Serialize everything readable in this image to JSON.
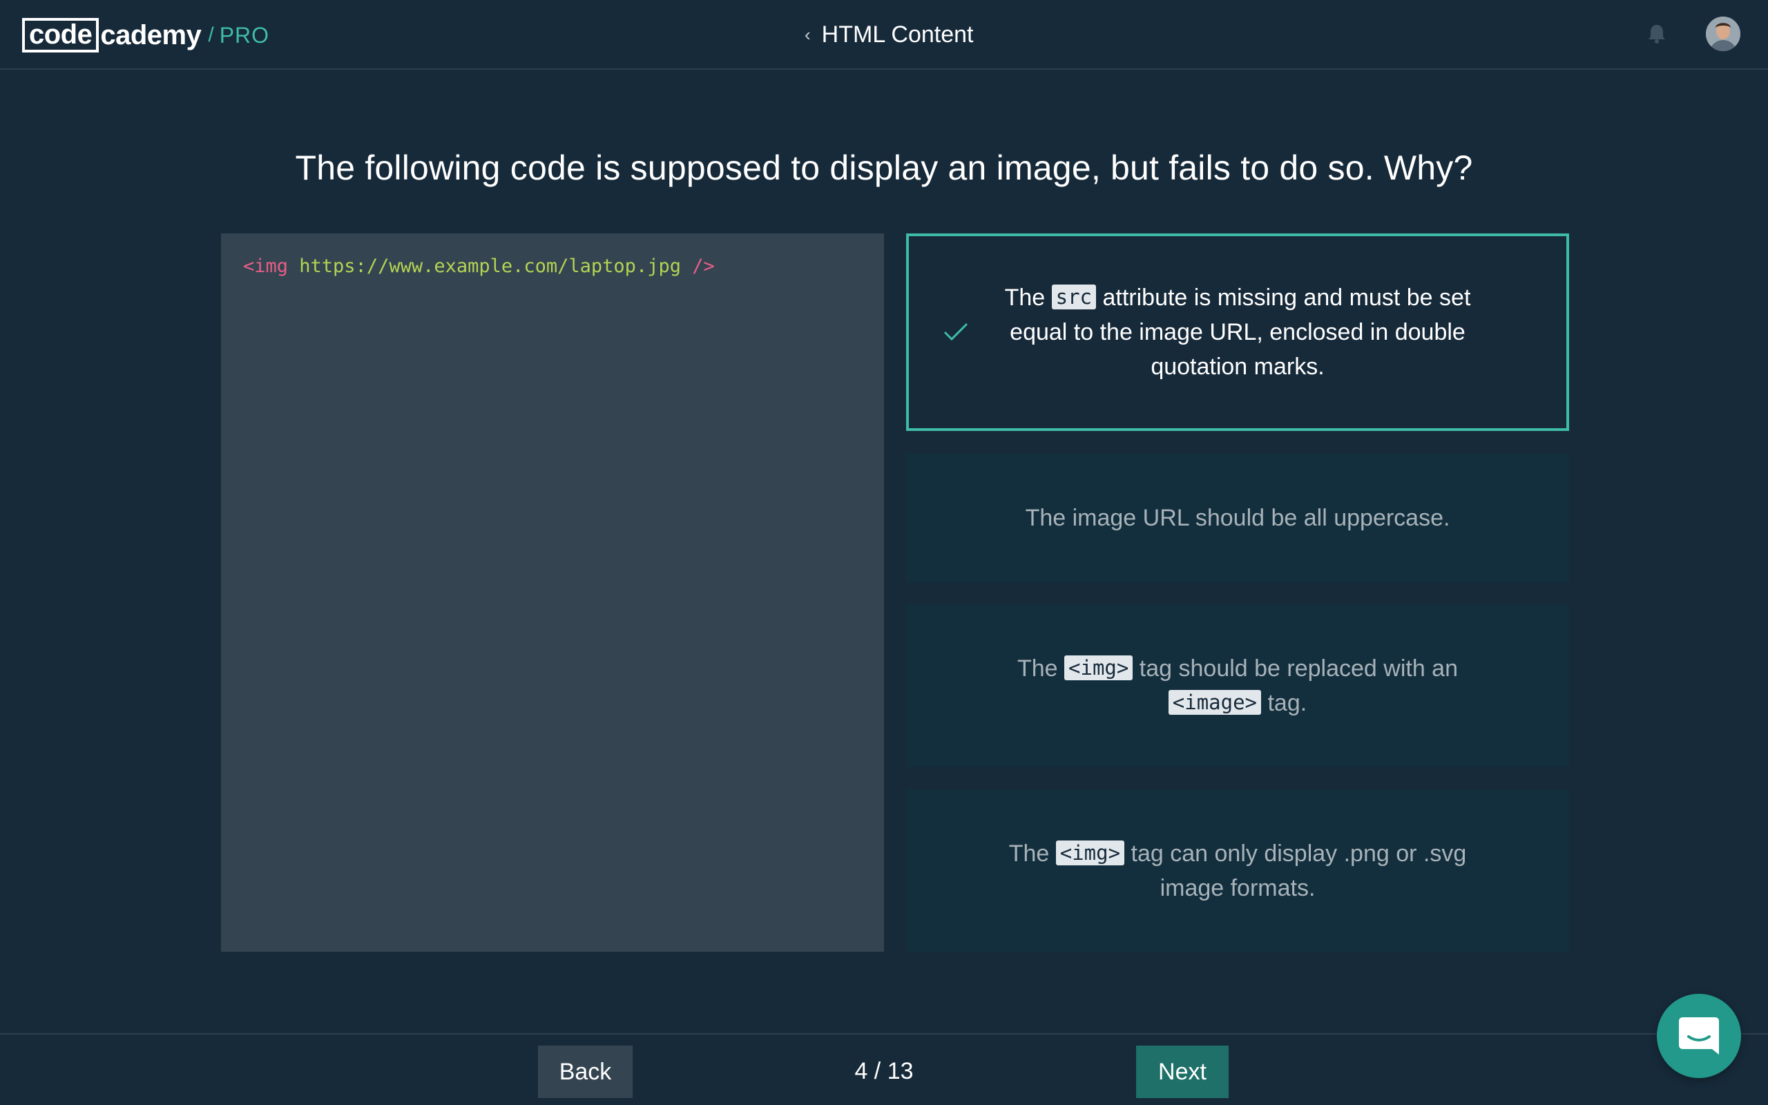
{
  "header": {
    "logo_code": "code",
    "logo_rest": "cademy",
    "logo_slash": "/",
    "logo_pro": "PRO",
    "back_chevron": "‹",
    "title": "HTML Content",
    "bell_icon": "bell-icon",
    "avatar_icon": "user-avatar"
  },
  "question": {
    "text": "The following code is supposed to display an image, but fails to do so. Why?"
  },
  "code": {
    "open": "<img ",
    "value": "https://www.example.com/laptop.jpg",
    "close": " />",
    "tag_color": "#e85e87",
    "value_color": "#b4d353"
  },
  "answers": [
    {
      "selected": true,
      "pre": "The ",
      "code": "src",
      "post": " attribute is missing and must be set equal to the image URL, enclosed in double quotation marks."
    },
    {
      "selected": false,
      "text": "The image URL should be all uppercase."
    },
    {
      "selected": false,
      "pre": "The ",
      "code": "<img>",
      "mid": " tag should be replaced with an ",
      "code2": "<image>",
      "post": " tag."
    },
    {
      "selected": false,
      "pre": "The ",
      "code": "<img>",
      "post": " tag can only display .png or .svg image formats."
    }
  ],
  "footer": {
    "back_label": "Back",
    "page_current": 4,
    "page_total": 13,
    "page_label": "4 / 13",
    "next_label": "Next",
    "chat_icon": "chat-icon"
  },
  "colors": {
    "background": "#172a3a",
    "accent": "#3fbca7",
    "code_bg": "#344551",
    "answer_bg": "#132f3d",
    "next_bg": "#1f7068",
    "chat_bg": "#22998a"
  }
}
